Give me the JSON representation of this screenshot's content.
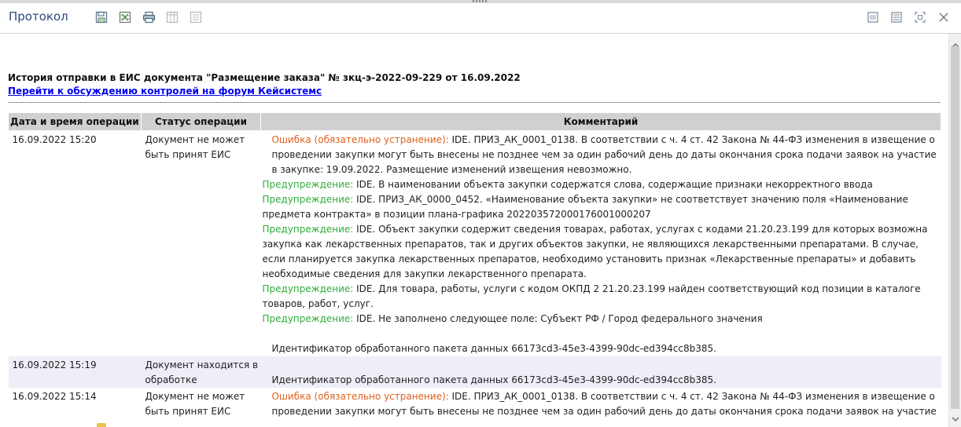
{
  "window": {
    "title": "Протокол",
    "toolbar_icons": [
      "save-icon",
      "export-excel-icon",
      "print-icon",
      "table-view-icon",
      "list-view-icon"
    ],
    "window_icons": [
      "minimize-icon",
      "restore-icon",
      "maximize-icon",
      "close-icon"
    ]
  },
  "document": {
    "heading": "История отправки в ЕИС документа \"Размещение заказа\" № зкц-э-2022-09-229 от 16.09.2022",
    "forum_link": "Перейти к обсуждению контролей на форум Кейсистемс"
  },
  "table": {
    "columns": [
      "Дата и время операции",
      "Статус операции",
      "Комментарий"
    ],
    "rows": [
      {
        "datetime": "16.09.2022 15:20",
        "status": "Документ не может быть принят ЕИС",
        "comments": [
          {
            "label": "Ошибка (обязательно устранение):",
            "text": " IDE. ПРИЗ_АК_0001_0138. В соответствии с ч. 4 ст. 42 Закона № 44-ФЗ изменения в извещение о проведении закупки могут быть внесены не позднее чем за один рабочий день до даты окончания срока подачи заявок на участие в закупке: 19.09.2022. Размещение изменений извещения невозможно."
          },
          {
            "label": "Предупреждение:",
            "text": " IDE. В наименовании  объекта закупки содержатся слова, содержащие признаки некорректного ввода"
          },
          {
            "label": "Предупреждение:",
            "text": " IDE. ПРИЗ_АК_0000_0452. «Наименование объекта закупки» не соответствует значению поля «Наименование предмета контракта» в позиции плана-графика 202203572000176001000207"
          },
          {
            "label": "Предупреждение:",
            "text": " IDE. Объект закупки содержит сведения товарах, работах, услугах с кодами 21.20.23.199 для которых возможна закупка как лекарственных препаратов, так и других объектов закупки, не являющихся лекарственными препаратами. В случае, если планируется закупка лекарственных препаратов, необходимо установить признак «Лекарственные препараты» и добавить необходимые сведения для закупки лекарственного препарата."
          },
          {
            "label": "Предупреждение:",
            "text": " IDE. Для товара, работы, услуги с кодом ОКПД 2 21.20.23.199 найден соответствующий код позиции в каталоге товаров, работ, услуг."
          },
          {
            "label": "Предупреждение:",
            "text": " IDE. Не заполнено следующее поле: Субъект РФ / Город федерального значения"
          }
        ],
        "package": "Идентификатор обработанного пакета данных 66173cd3-45e3-4399-90dc-ed394cc8b385."
      },
      {
        "datetime": "16.09.2022 15:19",
        "status": "Документ находится в обработке",
        "package": "Идентификатор обработанного пакета данных 66173cd3-45e3-4399-90dc-ed394cc8b385."
      },
      {
        "datetime": "16.09.2022 15:14",
        "status": "Документ не может быть принят ЕИС",
        "comments": [
          {
            "label": "Ошибка (обязательно устранение):",
            "text": " IDE. ПРИЗ_АК_0001_0138. В соответствии с ч. 4 ст. 42 Закона № 44-ФЗ изменения в извещение о проведении закупки могут быть внесены не позднее чем за один рабочий день до даты окончания срока подачи заявок на участие"
          }
        ]
      }
    ]
  },
  "colors": {
    "error": "#e0601f",
    "warning": "#2fae3a",
    "link": "#0000ee",
    "header_bg": "#d0d0d0",
    "alt_row_bg": "#eeeef8",
    "title_text": "#2a4a7a"
  }
}
